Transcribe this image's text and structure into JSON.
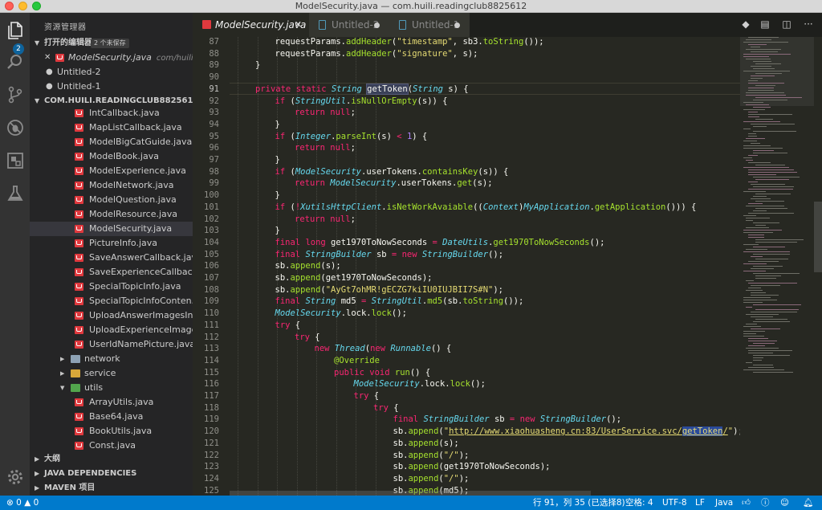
{
  "window": {
    "title": "ModelSecurity.java — com.huili.readingclub8825612"
  },
  "activity": {
    "explorer_badge": "2"
  },
  "sidebar": {
    "title": "资源管理器",
    "open_editors": {
      "label": "打开的编辑器",
      "badge": "2 个未保存",
      "items": [
        {
          "mark": "✕",
          "name": "ModelSecurity.java",
          "desc": "com/huili/..."
        },
        {
          "mark": "●",
          "name": "Untitled-2",
          "desc": ""
        },
        {
          "mark": "●",
          "name": "Untitled-1",
          "desc": ""
        }
      ]
    },
    "project": {
      "label": "COM.HUILI.READINGCLUB8825612",
      "files": [
        "IntCallback.java",
        "MapListCallback.java",
        "ModelBigCatGuide.java",
        "ModelBook.java",
        "ModelExperience.java",
        "ModelNetwork.java",
        "ModelQuestion.java",
        "ModelResource.java",
        "ModelSecurity.java",
        "PictureInfo.java",
        "SaveAnswerCallback.java",
        "SaveExperienceCallbac...",
        "SpecialTopicInfo.java",
        "SpecialTopicInfoConten...",
        "UploadAnswerImagesIn...",
        "UploadExperienceImage...",
        "UserIdNamePicture.java"
      ],
      "folders": [
        {
          "name": "network",
          "color": "grey",
          "open": false
        },
        {
          "name": "service",
          "color": "yellow",
          "open": false
        },
        {
          "name": "utils",
          "color": "green",
          "open": true
        }
      ],
      "util_files": [
        "ArrayUtils.java",
        "Base64.java",
        "BookUtils.java",
        "Const.java"
      ]
    },
    "outline_label": "大纲",
    "java_deps_label": "JAVA DEPENDENCIES",
    "maven_label": "MAVEN 项目"
  },
  "tabs": [
    {
      "label": "ModelSecurity.java",
      "active": true,
      "close": "✕"
    },
    {
      "label": "Untitled-2",
      "active": false
    },
    {
      "label": "Untitled-1",
      "active": false
    }
  ],
  "editor": {
    "line_numbers": [
      "87",
      "88",
      "89",
      "90",
      "91",
      "92",
      "93",
      "94",
      "95",
      "96",
      "97",
      "98",
      "99",
      "100",
      "101",
      "102",
      "103",
      "104",
      "105",
      "106",
      "107",
      "108",
      "109",
      "110",
      "111",
      "112",
      "113",
      "114",
      "115",
      "116",
      "117",
      "118",
      "119",
      "120",
      "121",
      "122",
      "123",
      "124",
      "125"
    ],
    "current_line": "91"
  },
  "code": [
    "requestParams.addHeader(\"timestamp\", sb3.toString());",
    "requestParams.addHeader(\"signature\", s);",
    "}",
    "",
    "private static String getToken(String s) {",
    "if (StringUtil.isNullOrEmpty(s)) {",
    "return null;",
    "}",
    "if (Integer.parseInt(s) < 1) {",
    "return null;",
    "}",
    "if (ModelSecurity.userTokens.containsKey(s)) {",
    "return ModelSecurity.userTokens.get(s);",
    "}",
    "if (!XutilsHttpClient.isNetWorkAvaiable((Context)MyApplication.getApplication())) {",
    "return null;",
    "}",
    "final long get1970ToNowSeconds = DateUtils.get1970ToNowSeconds();",
    "final StringBuilder sb = new StringBuilder();",
    "sb.append(s);",
    "sb.append(get1970ToNowSeconds);",
    "sb.append(\"AyGt7ohMR!gECZG7kiIU0IUJBII7S#N\");",
    "final String md5 = StringUtil.md5(sb.toString());",
    "ModelSecurity.lock.lock();",
    "try {",
    "try {",
    "new Thread(new Runnable() {",
    "@Override",
    "public void run() {",
    "ModelSecurity.lock.lock();",
    "try {",
    "try {",
    "final StringBuilder sb = new StringBuilder();",
    "sb.append(\"http://www.xiaohuasheng.cn:83/UserService.svc/getToken/\");",
    "sb.append(s);",
    "sb.append(\"/\");",
    "sb.append(get1970ToNowSeconds);",
    "sb.append(\"/\");",
    "sb.append(md5);"
  ],
  "statusbar": {
    "errors": "0",
    "warnings": "0",
    "position": "行 91，列 35 (已选择8)",
    "spaces": "空格: 4",
    "encoding": "UTF-8",
    "eol": "LF",
    "language": "Java"
  },
  "colors": {
    "statusbar": "#007acc",
    "editor_bg": "#272822",
    "sidebar_bg": "#252526"
  }
}
